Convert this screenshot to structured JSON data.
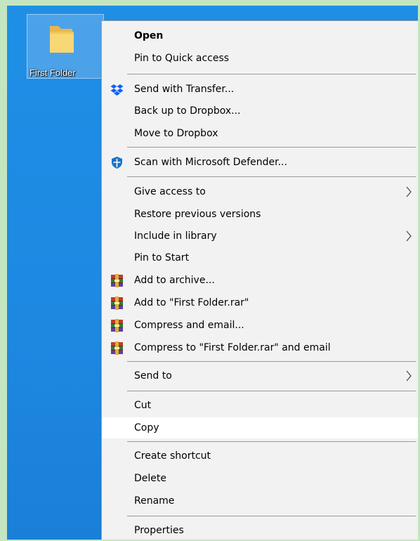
{
  "desktop": {
    "icon_label": "First Folder"
  },
  "menu": {
    "items": [
      {
        "label": "Open"
      },
      {
        "label": "Pin to Quick access"
      },
      {
        "label": "Send with Transfer..."
      },
      {
        "label": "Back up to Dropbox..."
      },
      {
        "label": "Move to Dropbox"
      },
      {
        "label": "Scan with Microsoft Defender..."
      },
      {
        "label": "Give access to"
      },
      {
        "label": "Restore previous versions"
      },
      {
        "label": "Include in library"
      },
      {
        "label": "Pin to Start"
      },
      {
        "label": "Add to archive..."
      },
      {
        "label": "Add to \"First Folder.rar\""
      },
      {
        "label": "Compress and email..."
      },
      {
        "label": "Compress to \"First Folder.rar\" and email"
      },
      {
        "label": "Send to"
      },
      {
        "label": "Cut"
      },
      {
        "label": "Copy"
      },
      {
        "label": "Create shortcut"
      },
      {
        "label": "Delete"
      },
      {
        "label": "Rename"
      },
      {
        "label": "Properties"
      }
    ],
    "highlighted_item": "Copy"
  },
  "icons": {
    "folder": "folder-icon",
    "dropbox": "dropbox-icon",
    "defender": "defender-shield-icon",
    "winrar": "winrar-icon",
    "submenu": "chevron-right-icon"
  },
  "colors": {
    "desktop": "#1e88e1",
    "page_bg": "#c3e6c0",
    "menu_bg": "#f2f2f2",
    "highlight": "#ffffff",
    "dropbox": "#0061fe",
    "defender": "#1a73c8"
  }
}
